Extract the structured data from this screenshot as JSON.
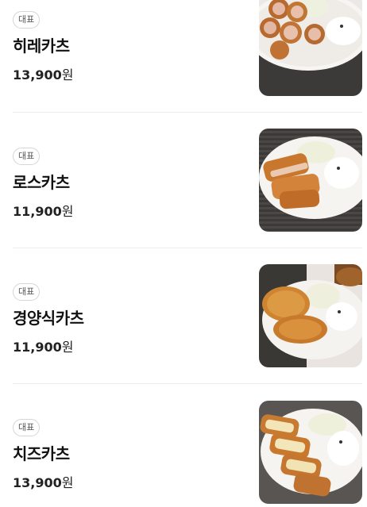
{
  "menu": {
    "items": [
      {
        "badge": "대표",
        "name": "히레카츠",
        "price": "13,900",
        "unit": "원",
        "image": "hire-katsu-photo"
      },
      {
        "badge": "대표",
        "name": "로스카츠",
        "price": "11,900",
        "unit": "원",
        "image": "rosu-katsu-photo"
      },
      {
        "badge": "대표",
        "name": "경양식카츠",
        "price": "11,900",
        "unit": "원",
        "image": "gyeongyangsik-katsu-photo"
      },
      {
        "badge": "대표",
        "name": "치즈카츠",
        "price": "13,900",
        "unit": "원",
        "image": "cheese-katsu-photo"
      }
    ]
  }
}
